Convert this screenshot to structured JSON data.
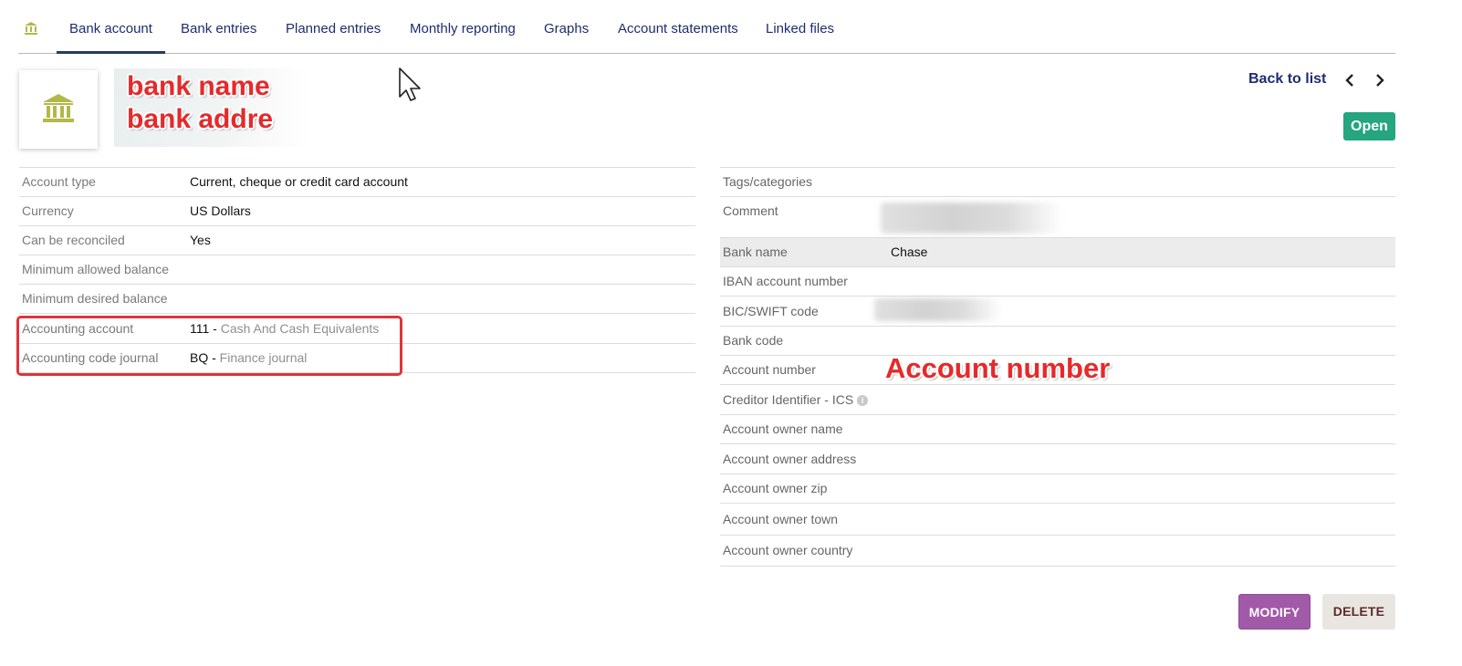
{
  "tabs": [
    {
      "label": "Bank account",
      "active": true
    },
    {
      "label": "Bank entries"
    },
    {
      "label": "Planned entries"
    },
    {
      "label": "Monthly reporting"
    },
    {
      "label": "Graphs"
    },
    {
      "label": "Account statements"
    },
    {
      "label": "Linked files"
    }
  ],
  "header": {
    "annotations": {
      "bank_name": "bank name",
      "bank_address": "bank addre"
    },
    "back_to_list": "Back to list",
    "status": "Open"
  },
  "left_fields": [
    {
      "label": "Account type",
      "value": "Current, cheque or credit card account"
    },
    {
      "label": "Currency",
      "value": "US Dollars"
    },
    {
      "label": "Can be reconciled",
      "value": "Yes"
    },
    {
      "label": "Minimum allowed balance",
      "value": ""
    },
    {
      "label": "Minimum desired balance",
      "value": ""
    },
    {
      "label": "Accounting account",
      "code": "111 - ",
      "value": "Cash And Cash Equivalents"
    },
    {
      "label": "Accounting code journal",
      "code": "BQ - ",
      "value": "Finance journal"
    }
  ],
  "right_fields": [
    {
      "label": "Tags/categories",
      "value": ""
    },
    {
      "label": "Comment",
      "value": ""
    },
    {
      "label": "Bank name",
      "value": "Chase"
    },
    {
      "label": "IBAN account number",
      "value": ""
    },
    {
      "label": "BIC/SWIFT code",
      "value": ""
    },
    {
      "label": "Bank code",
      "value": ""
    },
    {
      "label": "Account number",
      "value": ""
    },
    {
      "label": "Creditor Identifier - ICS",
      "value": ""
    },
    {
      "label": "Account owner name",
      "value": ""
    },
    {
      "label": "Account owner address",
      "value": ""
    },
    {
      "label": "Account owner zip",
      "value": ""
    },
    {
      "label": "Account owner town",
      "value": ""
    },
    {
      "label": "Account owner country",
      "value": ""
    }
  ],
  "annotation_account_number": "Account number",
  "buttons": {
    "modify": "MODIFY",
    "delete": "DELETE"
  },
  "colors": {
    "status": "#25a580",
    "modify": "#a05aa8",
    "delete_bg": "#e9e6e1",
    "tab_text": "#1f2d6e",
    "bank_icon": "#b3b84a",
    "annotation": "#e52a2a"
  }
}
